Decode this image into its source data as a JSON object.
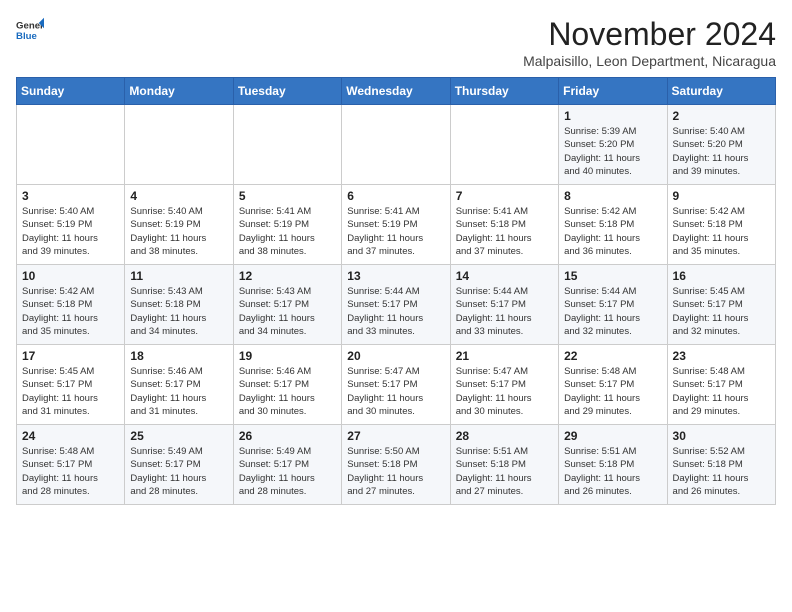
{
  "logo": {
    "general": "General",
    "blue": "Blue"
  },
  "header": {
    "month": "November 2024",
    "location": "Malpaisillo, Leon Department, Nicaragua"
  },
  "weekdays": [
    "Sunday",
    "Monday",
    "Tuesday",
    "Wednesday",
    "Thursday",
    "Friday",
    "Saturday"
  ],
  "weeks": [
    [
      {
        "day": "",
        "info": ""
      },
      {
        "day": "",
        "info": ""
      },
      {
        "day": "",
        "info": ""
      },
      {
        "day": "",
        "info": ""
      },
      {
        "day": "",
        "info": ""
      },
      {
        "day": "1",
        "info": "Sunrise: 5:39 AM\nSunset: 5:20 PM\nDaylight: 11 hours\nand 40 minutes."
      },
      {
        "day": "2",
        "info": "Sunrise: 5:40 AM\nSunset: 5:20 PM\nDaylight: 11 hours\nand 39 minutes."
      }
    ],
    [
      {
        "day": "3",
        "info": "Sunrise: 5:40 AM\nSunset: 5:19 PM\nDaylight: 11 hours\nand 39 minutes."
      },
      {
        "day": "4",
        "info": "Sunrise: 5:40 AM\nSunset: 5:19 PM\nDaylight: 11 hours\nand 38 minutes."
      },
      {
        "day": "5",
        "info": "Sunrise: 5:41 AM\nSunset: 5:19 PM\nDaylight: 11 hours\nand 38 minutes."
      },
      {
        "day": "6",
        "info": "Sunrise: 5:41 AM\nSunset: 5:19 PM\nDaylight: 11 hours\nand 37 minutes."
      },
      {
        "day": "7",
        "info": "Sunrise: 5:41 AM\nSunset: 5:18 PM\nDaylight: 11 hours\nand 37 minutes."
      },
      {
        "day": "8",
        "info": "Sunrise: 5:42 AM\nSunset: 5:18 PM\nDaylight: 11 hours\nand 36 minutes."
      },
      {
        "day": "9",
        "info": "Sunrise: 5:42 AM\nSunset: 5:18 PM\nDaylight: 11 hours\nand 35 minutes."
      }
    ],
    [
      {
        "day": "10",
        "info": "Sunrise: 5:42 AM\nSunset: 5:18 PM\nDaylight: 11 hours\nand 35 minutes."
      },
      {
        "day": "11",
        "info": "Sunrise: 5:43 AM\nSunset: 5:18 PM\nDaylight: 11 hours\nand 34 minutes."
      },
      {
        "day": "12",
        "info": "Sunrise: 5:43 AM\nSunset: 5:17 PM\nDaylight: 11 hours\nand 34 minutes."
      },
      {
        "day": "13",
        "info": "Sunrise: 5:44 AM\nSunset: 5:17 PM\nDaylight: 11 hours\nand 33 minutes."
      },
      {
        "day": "14",
        "info": "Sunrise: 5:44 AM\nSunset: 5:17 PM\nDaylight: 11 hours\nand 33 minutes."
      },
      {
        "day": "15",
        "info": "Sunrise: 5:44 AM\nSunset: 5:17 PM\nDaylight: 11 hours\nand 32 minutes."
      },
      {
        "day": "16",
        "info": "Sunrise: 5:45 AM\nSunset: 5:17 PM\nDaylight: 11 hours\nand 32 minutes."
      }
    ],
    [
      {
        "day": "17",
        "info": "Sunrise: 5:45 AM\nSunset: 5:17 PM\nDaylight: 11 hours\nand 31 minutes."
      },
      {
        "day": "18",
        "info": "Sunrise: 5:46 AM\nSunset: 5:17 PM\nDaylight: 11 hours\nand 31 minutes."
      },
      {
        "day": "19",
        "info": "Sunrise: 5:46 AM\nSunset: 5:17 PM\nDaylight: 11 hours\nand 30 minutes."
      },
      {
        "day": "20",
        "info": "Sunrise: 5:47 AM\nSunset: 5:17 PM\nDaylight: 11 hours\nand 30 minutes."
      },
      {
        "day": "21",
        "info": "Sunrise: 5:47 AM\nSunset: 5:17 PM\nDaylight: 11 hours\nand 30 minutes."
      },
      {
        "day": "22",
        "info": "Sunrise: 5:48 AM\nSunset: 5:17 PM\nDaylight: 11 hours\nand 29 minutes."
      },
      {
        "day": "23",
        "info": "Sunrise: 5:48 AM\nSunset: 5:17 PM\nDaylight: 11 hours\nand 29 minutes."
      }
    ],
    [
      {
        "day": "24",
        "info": "Sunrise: 5:48 AM\nSunset: 5:17 PM\nDaylight: 11 hours\nand 28 minutes."
      },
      {
        "day": "25",
        "info": "Sunrise: 5:49 AM\nSunset: 5:17 PM\nDaylight: 11 hours\nand 28 minutes."
      },
      {
        "day": "26",
        "info": "Sunrise: 5:49 AM\nSunset: 5:17 PM\nDaylight: 11 hours\nand 28 minutes."
      },
      {
        "day": "27",
        "info": "Sunrise: 5:50 AM\nSunset: 5:18 PM\nDaylight: 11 hours\nand 27 minutes."
      },
      {
        "day": "28",
        "info": "Sunrise: 5:51 AM\nSunset: 5:18 PM\nDaylight: 11 hours\nand 27 minutes."
      },
      {
        "day": "29",
        "info": "Sunrise: 5:51 AM\nSunset: 5:18 PM\nDaylight: 11 hours\nand 26 minutes."
      },
      {
        "day": "30",
        "info": "Sunrise: 5:52 AM\nSunset: 5:18 PM\nDaylight: 11 hours\nand 26 minutes."
      }
    ]
  ]
}
